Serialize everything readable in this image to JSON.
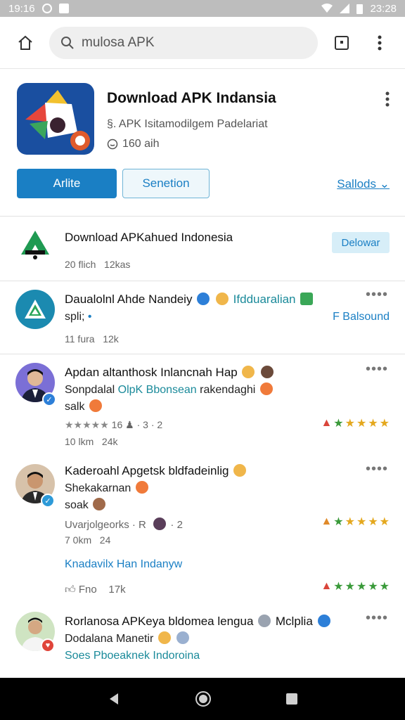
{
  "status_bar": {
    "time_left": "19:16",
    "time_right": "23:28"
  },
  "browser": {
    "url_text": "mulosa APK"
  },
  "app": {
    "title": "Download APK Indansia",
    "subtitle": "APK Isitamodilgem Padelariat",
    "meta": "160 aih",
    "primary_button": "Arlite",
    "secondary_button": "Senetion",
    "right_link": "Sallods"
  },
  "rows": [
    {
      "title": "Download APKahued Indonesia",
      "meta_a": "20 flich",
      "meta_b": "12kas",
      "tag": "Delowar"
    },
    {
      "title": "Daualolnl Ahde Nandeiy",
      "title_suffix": "Ifdduaralian",
      "line2": "spli;",
      "right_label": "F Balsound",
      "meta_a": "11 fura",
      "meta_b": "12k"
    },
    {
      "title": "Apdan altanthosk Inlancnah Hap",
      "line2a": "Sonpdalal",
      "line2b": "OlpK Bbonsean",
      "line2c": "rakendaghi",
      "line3": "salk",
      "rating_text": "16",
      "rating_b": "3",
      "rating_c": "2",
      "meta_a": "10 lkm",
      "meta_b": "24k"
    },
    {
      "title": "Kaderoahl Apgetsk bldfadeinlig",
      "line2": "Shekakarnan",
      "line3": "soak",
      "rating_text": "Uvarjolgeorks",
      "rating_b": "R",
      "rating_c": "2",
      "meta_a": "7 0km",
      "meta_b": "24",
      "link": "Knadavilx Han Indanyw",
      "likes": "Fno",
      "likes_b": "17k"
    },
    {
      "title": "Rorlanosa APKeya bldomea lengua",
      "title_suffix": "Mclplia",
      "line2": "Dodalana Manetir",
      "link": "Soes Pboeaknek Indoroina"
    }
  ],
  "colors": {
    "accent": "#1a7fc4",
    "star_green": "#3a9a3a",
    "star_yellow": "#e4a81e"
  }
}
